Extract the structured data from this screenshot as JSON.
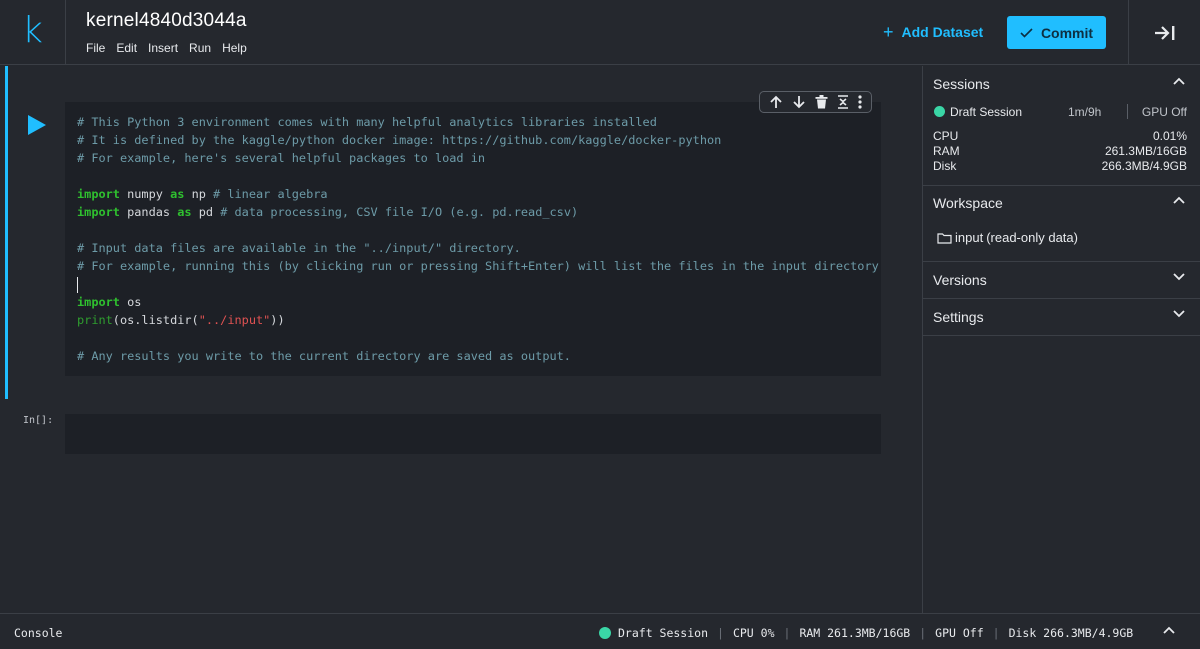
{
  "header": {
    "logo": "k",
    "title": "kernel4840d3044a",
    "menu": [
      "File",
      "Edit",
      "Insert",
      "Run",
      "Help"
    ],
    "add_dataset_label": "Add Dataset",
    "commit_label": "Commit"
  },
  "notebook": {
    "code_lines": [
      "# This Python 3 environment comes with many helpful analytics libraries installed",
      "# It is defined by the kaggle/python docker image: https://github.com/kaggle/docker-python",
      "# For example, here's several helpful packages to load in",
      "",
      "import numpy as np # linear algebra",
      "import pandas as pd # data processing, CSV file I/O (e.g. pd.read_csv)",
      "",
      "# Input data files are available in the \"../input/\" directory.",
      "# For example, running this (by clicking run or pressing Shift+Enter) will list the files in the input directory",
      "",
      "import os",
      "print(os.listdir(\"../input\"))",
      "",
      "# Any results you write to the current directory are saved as output."
    ],
    "empty_cell_prompt": "In[]:"
  },
  "sidebar": {
    "sessions": {
      "title": "Sessions",
      "session_name": "Draft Session",
      "time": "1m/9h",
      "gpu": "GPU Off",
      "stats": [
        {
          "label": "CPU",
          "value": "0.01%"
        },
        {
          "label": "RAM",
          "value": "261.3MB/16GB"
        },
        {
          "label": "Disk",
          "value": "266.3MB/4.9GB"
        }
      ]
    },
    "workspace": {
      "title": "Workspace",
      "item_name": "input",
      "item_note": "(read-only data)"
    },
    "versions_title": "Versions",
    "settings_title": "Settings"
  },
  "statusbar": {
    "console_label": "Console",
    "session": "Draft Session",
    "cpu": "CPU 0%",
    "ram": "RAM 261.3MB/16GB",
    "gpu": "GPU Off",
    "disk": "Disk 266.3MB/4.9GB"
  },
  "colors": {
    "accent": "#20beff",
    "status_green": "#3ad6a6",
    "background": "#25282e",
    "cell_background": "#1d2026"
  }
}
